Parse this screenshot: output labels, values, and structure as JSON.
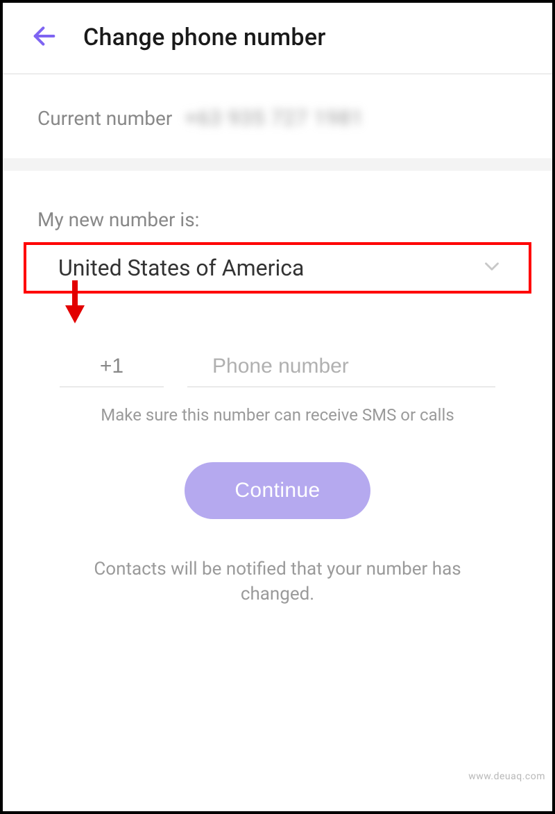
{
  "header": {
    "title": "Change phone number"
  },
  "current": {
    "label": "Current number",
    "value_blurred": "+63 935 727 1981"
  },
  "new_number": {
    "label": "My new number is:",
    "country": "United States of America",
    "dial_code": "+1",
    "phone_placeholder": "Phone number",
    "hint": "Make sure this number can receive SMS or calls"
  },
  "continue_label": "Continue",
  "notify_text": "Contacts will be notified that your number has changed.",
  "watermark": "www.deuaq.com"
}
